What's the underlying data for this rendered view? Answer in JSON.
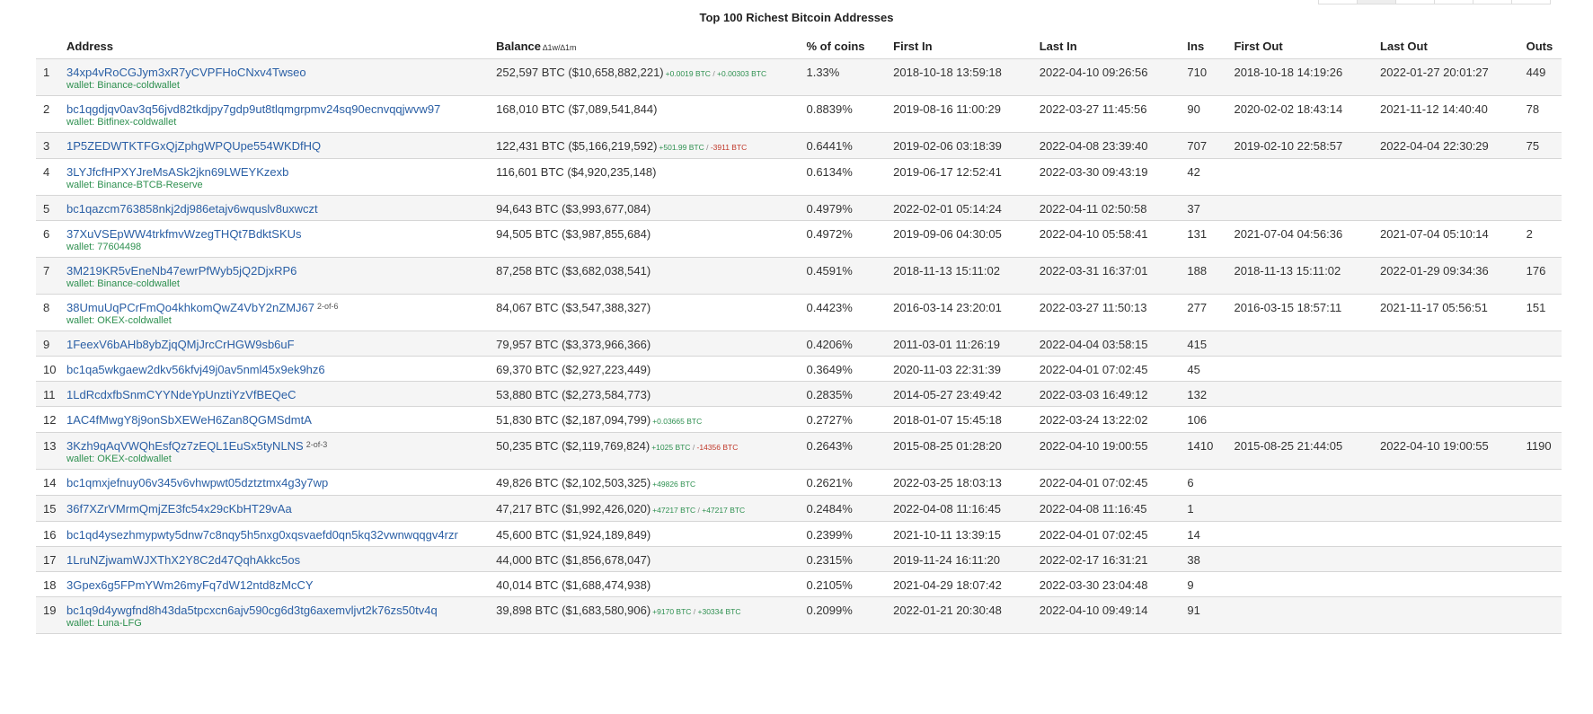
{
  "title": "Top 100 Richest Bitcoin Addresses",
  "columns": {
    "address": "Address",
    "balance": "Balance",
    "delta": "∆1w/∆1m",
    "percent": "% of coins",
    "first_in": "First In",
    "last_in": "Last In",
    "ins": "Ins",
    "first_out": "First Out",
    "last_out": "Last Out",
    "outs": "Outs"
  },
  "rows": [
    {
      "rank": "1",
      "address": "34xp4vRoCGJym3xR7yCVPFHoCNxv4Twseo",
      "multisig": "",
      "wallet": "wallet: Binance-coldwallet",
      "balance": "252,597 BTC ($10,658,882,221)",
      "d1w": "+0.0019 BTC",
      "d1m": "+0.00303 BTC",
      "d1w_sign": "pos",
      "d1m_sign": "pos",
      "percent": "1.33%",
      "first_in": "2018-10-18 13:59:18",
      "last_in": "2022-04-10 09:26:56",
      "ins": "710",
      "first_out": "2018-10-18 14:19:26",
      "last_out": "2022-01-27 20:01:27",
      "outs": "449"
    },
    {
      "rank": "2",
      "address": "bc1qgdjqv0av3q56jvd82tkdjpy7gdp9ut8tlqmgrpmv24sq90ecnvqqjwvw97",
      "multisig": "",
      "wallet": "wallet: Bitfinex-coldwallet",
      "balance": "168,010 BTC ($7,089,541,844)",
      "d1w": "",
      "d1m": "",
      "d1w_sign": "",
      "d1m_sign": "",
      "percent": "0.8839%",
      "first_in": "2019-08-16 11:00:29",
      "last_in": "2022-03-27 11:45:56",
      "ins": "90",
      "first_out": "2020-02-02 18:43:14",
      "last_out": "2021-11-12 14:40:40",
      "outs": "78"
    },
    {
      "rank": "3",
      "address": "1P5ZEDWTKTFGxQjZphgWPQUpe554WKDfHQ",
      "multisig": "",
      "wallet": "",
      "balance": "122,431 BTC ($5,166,219,592)",
      "d1w": "+501.99 BTC",
      "d1m": "-3911 BTC",
      "d1w_sign": "pos",
      "d1m_sign": "neg",
      "percent": "0.6441%",
      "first_in": "2019-02-06 03:18:39",
      "last_in": "2022-04-08 23:39:40",
      "ins": "707",
      "first_out": "2019-02-10 22:58:57",
      "last_out": "2022-04-04 22:30:29",
      "outs": "75"
    },
    {
      "rank": "4",
      "address": "3LYJfcfHPXYJreMsASk2jkn69LWEYKzexb",
      "multisig": "",
      "wallet": "wallet: Binance-BTCB-Reserve",
      "balance": "116,601 BTC ($4,920,235,148)",
      "d1w": "",
      "d1m": "",
      "d1w_sign": "",
      "d1m_sign": "",
      "percent": "0.6134%",
      "first_in": "2019-06-17 12:52:41",
      "last_in": "2022-03-30 09:43:19",
      "ins": "42",
      "first_out": "",
      "last_out": "",
      "outs": ""
    },
    {
      "rank": "5",
      "address": "bc1qazcm763858nkj2dj986etajv6wquslv8uxwczt",
      "multisig": "",
      "wallet": "",
      "balance": "94,643 BTC ($3,993,677,084)",
      "d1w": "",
      "d1m": "",
      "d1w_sign": "",
      "d1m_sign": "",
      "percent": "0.4979%",
      "first_in": "2022-02-01 05:14:24",
      "last_in": "2022-04-11 02:50:58",
      "ins": "37",
      "first_out": "",
      "last_out": "",
      "outs": ""
    },
    {
      "rank": "6",
      "address": "37XuVSEpWW4trkfmvWzegTHQt7BdktSKUs",
      "multisig": "",
      "wallet": "wallet: 77604498",
      "balance": "94,505 BTC ($3,987,855,684)",
      "d1w": "",
      "d1m": "",
      "d1w_sign": "",
      "d1m_sign": "",
      "percent": "0.4972%",
      "first_in": "2019-09-06 04:30:05",
      "last_in": "2022-04-10 05:58:41",
      "ins": "131",
      "first_out": "2021-07-04 04:56:36",
      "last_out": "2021-07-04 05:10:14",
      "outs": "2"
    },
    {
      "rank": "7",
      "address": "3M219KR5vEneNb47ewrPfWyb5jQ2DjxRP6",
      "multisig": "",
      "wallet": "wallet: Binance-coldwallet",
      "balance": "87,258 BTC ($3,682,038,541)",
      "d1w": "",
      "d1m": "",
      "d1w_sign": "",
      "d1m_sign": "",
      "percent": "0.4591%",
      "first_in": "2018-11-13 15:11:02",
      "last_in": "2022-03-31 16:37:01",
      "ins": "188",
      "first_out": "2018-11-13 15:11:02",
      "last_out": "2022-01-29 09:34:36",
      "outs": "176"
    },
    {
      "rank": "8",
      "address": "38UmuUqPCrFmQo4khkomQwZ4VbY2nZMJ67",
      "multisig": "2-of-6",
      "wallet": "wallet: OKEX-coldwallet",
      "balance": "84,067 BTC ($3,547,388,327)",
      "d1w": "",
      "d1m": "",
      "d1w_sign": "",
      "d1m_sign": "",
      "percent": "0.4423%",
      "first_in": "2016-03-14 23:20:01",
      "last_in": "2022-03-27 11:50:13",
      "ins": "277",
      "first_out": "2016-03-15 18:57:11",
      "last_out": "2021-11-17 05:56:51",
      "outs": "151"
    },
    {
      "rank": "9",
      "address": "1FeexV6bAHb8ybZjqQMjJrcCrHGW9sb6uF",
      "multisig": "",
      "wallet": "",
      "balance": "79,957 BTC ($3,373,966,366)",
      "d1w": "",
      "d1m": "",
      "d1w_sign": "",
      "d1m_sign": "",
      "percent": "0.4206%",
      "first_in": "2011-03-01 11:26:19",
      "last_in": "2022-04-04 03:58:15",
      "ins": "415",
      "first_out": "",
      "last_out": "",
      "outs": ""
    },
    {
      "rank": "10",
      "address": "bc1qa5wkgaew2dkv56kfvj49j0av5nml45x9ek9hz6",
      "multisig": "",
      "wallet": "",
      "balance": "69,370 BTC ($2,927,223,449)",
      "d1w": "",
      "d1m": "",
      "d1w_sign": "",
      "d1m_sign": "",
      "percent": "0.3649%",
      "first_in": "2020-11-03 22:31:39",
      "last_in": "2022-04-01 07:02:45",
      "ins": "45",
      "first_out": "",
      "last_out": "",
      "outs": ""
    },
    {
      "rank": "11",
      "address": "1LdRcdxfbSnmCYYNdeYpUnztiYzVfBEQeC",
      "multisig": "",
      "wallet": "",
      "balance": "53,880 BTC ($2,273,584,773)",
      "d1w": "",
      "d1m": "",
      "d1w_sign": "",
      "d1m_sign": "",
      "percent": "0.2835%",
      "first_in": "2014-05-27 23:49:42",
      "last_in": "2022-03-03 16:49:12",
      "ins": "132",
      "first_out": "",
      "last_out": "",
      "outs": ""
    },
    {
      "rank": "12",
      "address": "1AC4fMwgY8j9onSbXEWeH6Zan8QGMSdmtA",
      "multisig": "",
      "wallet": "",
      "balance": "51,830 BTC ($2,187,094,799)",
      "d1w": "+0.03665 BTC",
      "d1m": "",
      "d1w_sign": "pos",
      "d1m_sign": "",
      "percent": "0.2727%",
      "first_in": "2018-01-07 15:45:18",
      "last_in": "2022-03-24 13:22:02",
      "ins": "106",
      "first_out": "",
      "last_out": "",
      "outs": ""
    },
    {
      "rank": "13",
      "address": "3Kzh9qAqVWQhEsfQz7zEQL1EuSx5tyNLNS",
      "multisig": "2-of-3",
      "wallet": "wallet: OKEX-coldwallet",
      "balance": "50,235 BTC ($2,119,769,824)",
      "d1w": "+1025 BTC",
      "d1m": "-14356 BTC",
      "d1w_sign": "pos",
      "d1m_sign": "neg",
      "percent": "0.2643%",
      "first_in": "2015-08-25 01:28:20",
      "last_in": "2022-04-10 19:00:55",
      "ins": "1410",
      "first_out": "2015-08-25 21:44:05",
      "last_out": "2022-04-10 19:00:55",
      "outs": "1190"
    },
    {
      "rank": "14",
      "address": "bc1qmxjefnuy06v345v6vhwpwt05dztztmx4g3y7wp",
      "multisig": "",
      "wallet": "",
      "balance": "49,826 BTC ($2,102,503,325)",
      "d1w": "+49826 BTC",
      "d1m": "",
      "d1w_sign": "pos",
      "d1m_sign": "",
      "percent": "0.2621%",
      "first_in": "2022-03-25 18:03:13",
      "last_in": "2022-04-01 07:02:45",
      "ins": "6",
      "first_out": "",
      "last_out": "",
      "outs": ""
    },
    {
      "rank": "15",
      "address": "36f7XZrVMrmQmjZE3fc54x29cKbHT29vAa",
      "multisig": "",
      "wallet": "",
      "balance": "47,217 BTC ($1,992,426,020)",
      "d1w": "+47217 BTC",
      "d1m": "+47217 BTC",
      "d1w_sign": "pos",
      "d1m_sign": "pos",
      "percent": "0.2484%",
      "first_in": "2022-04-08 11:16:45",
      "last_in": "2022-04-08 11:16:45",
      "ins": "1",
      "first_out": "",
      "last_out": "",
      "outs": ""
    },
    {
      "rank": "16",
      "address": "bc1qd4ysezhmypwty5dnw7c8nqy5h5nxg0xqsvaefd0qn5kq32vwnwqqgv4rzr",
      "multisig": "",
      "wallet": "",
      "balance": "45,600 BTC ($1,924,189,849)",
      "d1w": "",
      "d1m": "",
      "d1w_sign": "",
      "d1m_sign": "",
      "percent": "0.2399%",
      "first_in": "2021-10-11 13:39:15",
      "last_in": "2022-04-01 07:02:45",
      "ins": "14",
      "first_out": "",
      "last_out": "",
      "outs": ""
    },
    {
      "rank": "17",
      "address": "1LruNZjwamWJXThX2Y8C2d47QqhAkkc5os",
      "multisig": "",
      "wallet": "",
      "balance": "44,000 BTC ($1,856,678,047)",
      "d1w": "",
      "d1m": "",
      "d1w_sign": "",
      "d1m_sign": "",
      "percent": "0.2315%",
      "first_in": "2019-11-24 16:11:20",
      "last_in": "2022-02-17 16:31:21",
      "ins": "38",
      "first_out": "",
      "last_out": "",
      "outs": ""
    },
    {
      "rank": "18",
      "address": "3Gpex6g5FPmYWm26myFq7dW12ntd8zMcCY",
      "multisig": "",
      "wallet": "",
      "balance": "40,014 BTC ($1,688,474,938)",
      "d1w": "",
      "d1m": "",
      "d1w_sign": "",
      "d1m_sign": "",
      "percent": "0.2105%",
      "first_in": "2021-04-29 18:07:42",
      "last_in": "2022-03-30 23:04:48",
      "ins": "9",
      "first_out": "",
      "last_out": "",
      "outs": ""
    },
    {
      "rank": "19",
      "address": "bc1q9d4ywgfnd8h43da5tpcxcn6ajv590cg6d3tg6axemvljvt2k76zs50tv4q",
      "multisig": "",
      "wallet": "wallet: Luna-LFG",
      "balance": "39,898 BTC ($1,683,580,906)",
      "d1w": "+9170 BTC",
      "d1m": "+30334 BTC",
      "d1w_sign": "pos",
      "d1m_sign": "pos",
      "percent": "0.2099%",
      "first_in": "2022-01-21 20:30:48",
      "last_in": "2022-04-10 09:49:14",
      "ins": "91",
      "first_out": "",
      "last_out": "",
      "outs": ""
    }
  ]
}
